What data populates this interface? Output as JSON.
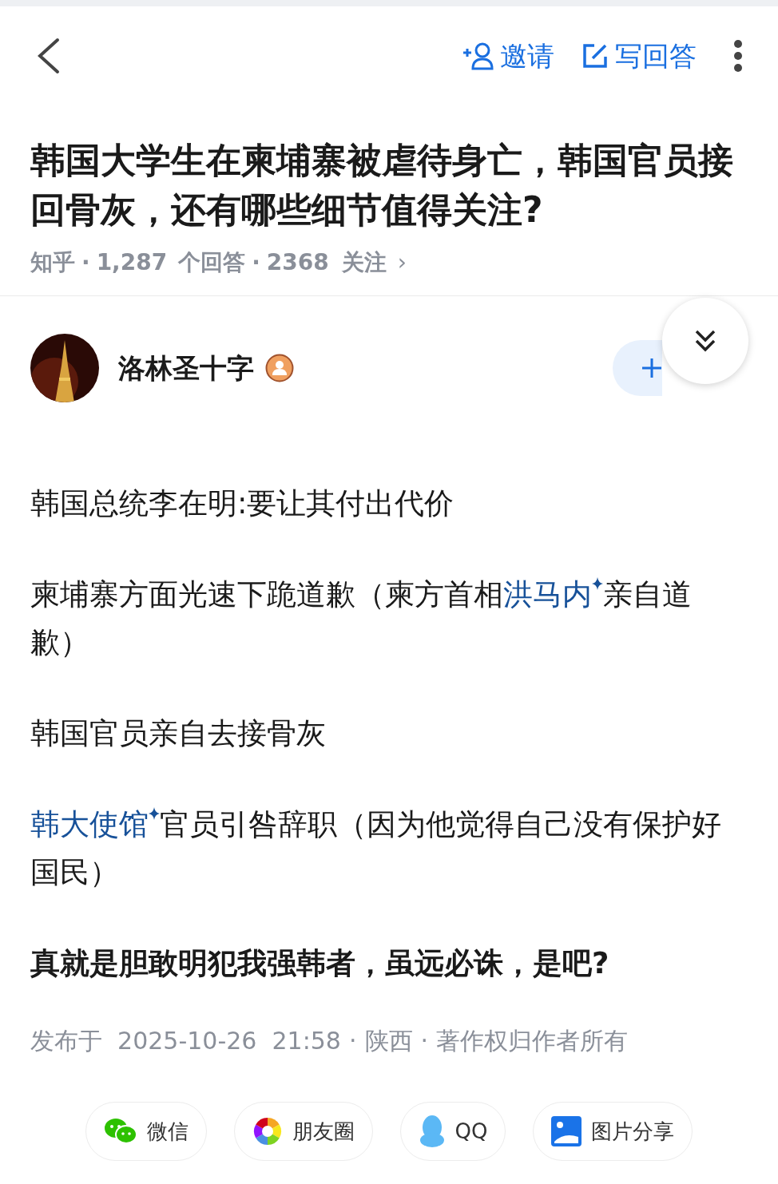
{
  "top_bar": {
    "invite": "邀请",
    "write_answer": "写回答"
  },
  "question": {
    "title": "韩国大学生在柬埔寨被虐待身亡，韩国官员接回骨灰，还有哪些细节值得关注?",
    "source": "知乎",
    "separator_1": "·",
    "answers_count": "1,287",
    "answers_label": "个回答",
    "separator_2": "·",
    "follow_count": "2368",
    "follow_label": "关注",
    "chevron": "›"
  },
  "author": {
    "name": "洛林圣十字"
  },
  "paragraphs": [
    {
      "kind": "plain",
      "segments": [
        {
          "kind": "text",
          "text": "韩国总统李在明:要让其付出代价"
        }
      ]
    },
    {
      "kind": "plain",
      "segments": [
        {
          "kind": "text",
          "text": "柬埔寨方面光速下跪道歉（柬方首相"
        },
        {
          "kind": "link",
          "text": "洪马内"
        },
        {
          "kind": "text",
          "text": "亲自道歉）"
        }
      ]
    },
    {
      "kind": "plain",
      "segments": [
        {
          "kind": "text",
          "text": "韩国官员亲自去接骨灰"
        }
      ]
    },
    {
      "kind": "plain",
      "segments": [
        {
          "kind": "link",
          "text": "韩大使馆"
        },
        {
          "kind": "text",
          "text": "官员引咎辞职（因为他觉得自己没有保护好国民）"
        }
      ]
    },
    {
      "kind": "bold",
      "segments": [
        {
          "kind": "text",
          "text": "真就是胆敢明犯我强韩者，虽远必诛，是吧?"
        }
      ]
    }
  ],
  "published": {
    "date": "发布于  2025-10-26  21:58",
    "separator_1": "·",
    "region": "陕西",
    "separator_2": "·",
    "copyright": "著作权归作者所有"
  },
  "share": [
    {
      "kind": "wechat",
      "label": "微信"
    },
    {
      "kind": "moments",
      "label": "朋友圈"
    },
    {
      "kind": "qq",
      "label": "QQ"
    },
    {
      "kind": "image",
      "label": "图片分享"
    }
  ]
}
